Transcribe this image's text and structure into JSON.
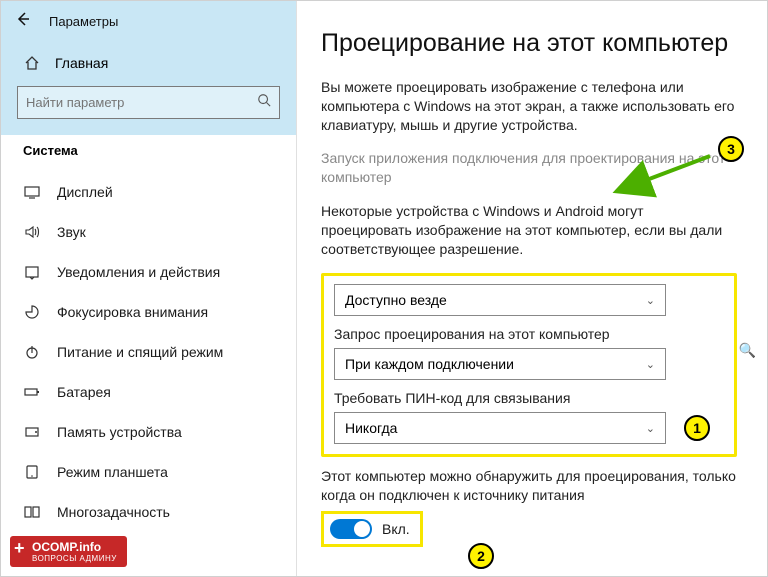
{
  "header": {
    "title": "Параметры"
  },
  "sidebar": {
    "home": "Главная",
    "search_placeholder": "Найти параметр",
    "category": "Система",
    "items": [
      {
        "label": "Дисплей",
        "icon": "display-icon"
      },
      {
        "label": "Звук",
        "icon": "sound-icon"
      },
      {
        "label": "Уведомления и действия",
        "icon": "notifications-icon"
      },
      {
        "label": "Фокусировка внимания",
        "icon": "focus-icon"
      },
      {
        "label": "Питание и спящий режим",
        "icon": "power-icon"
      },
      {
        "label": "Батарея",
        "icon": "battery-icon"
      },
      {
        "label": "Память устройства",
        "icon": "storage-icon"
      },
      {
        "label": "Режим планшета",
        "icon": "tablet-icon"
      },
      {
        "label": "Многозадачность",
        "icon": "multitask-icon"
      }
    ]
  },
  "main": {
    "title": "Проецирование на этот компьютер",
    "intro": "Вы можете проецировать изображение с телефона или компьютера с Windows на этот экран, а также использовать его клавиатуру, мышь и другие устройства.",
    "connect_link": "Запуск приложения подключения для проектирования на этот компьютер",
    "permission_note": "Некоторые устройства с Windows и Android могут проецировать изображение на этот компьютер, если вы дали соответствующее разрешение.",
    "dropdown1_label": "",
    "dropdown1_value": "Доступно везде",
    "dropdown2_label": "Запрос проецирования на этот компьютер",
    "dropdown2_value": "При каждом подключении",
    "dropdown3_label": "Требовать ПИН-код для связывания",
    "dropdown3_value": "Никогда",
    "discover_note": "Этот компьютер можно обнаружить для проецирования, только когда он подключен к источнику питания",
    "toggle_label": "Вкл."
  },
  "callouts": {
    "c1": "1",
    "c2": "2",
    "c3": "3"
  },
  "watermark": {
    "main": "OCOMP.info",
    "sub": "ВОПРОСЫ АДМИНУ"
  }
}
